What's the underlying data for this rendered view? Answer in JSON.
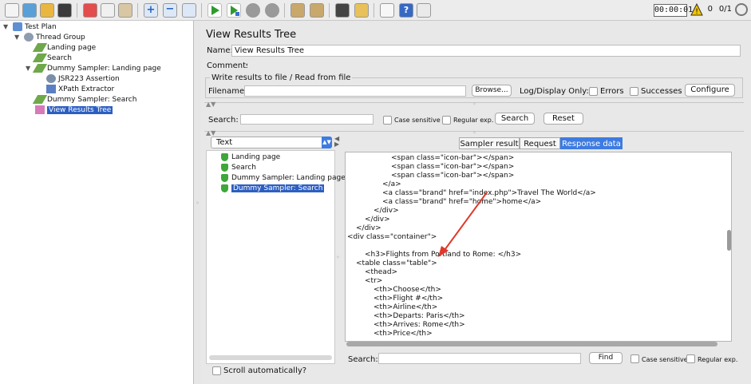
{
  "toolbar": {
    "timer": "00:00:01",
    "warning_count": "0",
    "thread_ratio": "0/1"
  },
  "tree": {
    "items": [
      {
        "label": "Test Plan"
      },
      {
        "label": "Thread Group"
      },
      {
        "label": "Landing page"
      },
      {
        "label": "Search"
      },
      {
        "label": "Dummy Sampler: Landing page"
      },
      {
        "label": "JSR223 Assertion"
      },
      {
        "label": "XPath Extractor"
      },
      {
        "label": "Dummy Sampler: Search"
      },
      {
        "label": "View Results Tree"
      }
    ]
  },
  "panel": {
    "title": "View Results Tree",
    "name_label": "Name:",
    "name_value": "View Results Tree",
    "comments_label": "Comments:",
    "write_group_label": "Write results to file / Read from file",
    "filename_label": "Filename",
    "browse_label": "Browse...",
    "log_display_label": "Log/Display Only:",
    "errors_label": "Errors",
    "successes_label": "Successes",
    "configure_label": "Configure",
    "search_label": "Search:",
    "case_sensitive_label": "Case sensitive",
    "regular_exp_label": "Regular exp.",
    "search_button": "Search",
    "reset_button": "Reset"
  },
  "results": {
    "renderer": "Text",
    "items": [
      "Landing page",
      "Search",
      "Dummy Sampler: Landing page",
      "Dummy Sampler: Search"
    ],
    "scroll_auto_label": "Scroll automatically?"
  },
  "tabs": [
    {
      "label": "Sampler result"
    },
    {
      "label": "Request"
    },
    {
      "label": "Response data"
    }
  ],
  "response": {
    "lines": [
      "<span class=\"icon-bar\"></span>",
      "<span class=\"icon-bar\"></span>",
      "<span class=\"icon-bar\"></span>",
      "</a>",
      "<a class=\"brand\" href=\"index.php\">Travel The World</a>",
      "<a class=\"brand\" href=\"home\">home</a>",
      "</div>",
      "</div>",
      "</div>",
      "<div class=\"container\">",
      "",
      "<h3>Flights from Portland to Rome: </h3>",
      "<table class=\"table\">",
      "<thead>",
      "<tr>",
      "<th>Choose</th>",
      "<th>Flight #</th>",
      "<th>Airline</th>",
      "<th>Departs: Paris</th>",
      "<th>Arrives: Rome</th>",
      "<th>Price</th>"
    ],
    "search_label": "Search:",
    "find_label": "Find",
    "case_sensitive_label": "Case sensitive",
    "regular_exp_label": "Regular exp."
  },
  "colors": {
    "selection": "#2d5fc2",
    "active_tab": "#3d7be0",
    "arrow": "#e0392b",
    "success": "#3ea63a"
  }
}
